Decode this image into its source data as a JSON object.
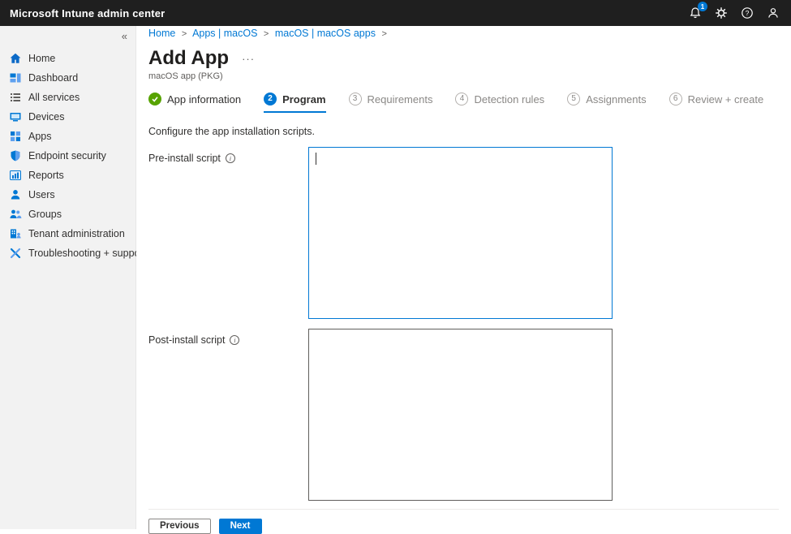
{
  "topbar": {
    "title": "Microsoft Intune admin center",
    "notification_badge": "1",
    "icons": [
      "bell-icon",
      "gear-icon",
      "help-icon",
      "person-icon"
    ]
  },
  "sidebar": {
    "collapse_glyph": "«",
    "items": [
      {
        "label": "Home",
        "icon": "home-icon"
      },
      {
        "label": "Dashboard",
        "icon": "dashboard-icon"
      },
      {
        "label": "All services",
        "icon": "all-services-icon"
      },
      {
        "label": "Devices",
        "icon": "devices-icon"
      },
      {
        "label": "Apps",
        "icon": "apps-icon"
      },
      {
        "label": "Endpoint security",
        "icon": "endpoint-security-icon"
      },
      {
        "label": "Reports",
        "icon": "reports-icon"
      },
      {
        "label": "Users",
        "icon": "users-icon"
      },
      {
        "label": "Groups",
        "icon": "groups-icon"
      },
      {
        "label": "Tenant administration",
        "icon": "tenant-administration-icon"
      },
      {
        "label": "Troubleshooting + support",
        "icon": "troubleshooting-icon"
      }
    ]
  },
  "breadcrumb": {
    "separator": ">",
    "items": [
      "Home",
      "Apps | macOS",
      "macOS | macOS apps"
    ]
  },
  "page": {
    "title": "Add App",
    "menu_glyph": "···",
    "subtitle": "macOS app (PKG)"
  },
  "wizard": {
    "steps": [
      {
        "label": "App information",
        "state": "complete"
      },
      {
        "number": "2",
        "label": "Program",
        "state": "active"
      },
      {
        "number": "3",
        "label": "Requirements",
        "state": "upcoming"
      },
      {
        "number": "4",
        "label": "Detection rules",
        "state": "upcoming"
      },
      {
        "number": "5",
        "label": "Assignments",
        "state": "upcoming"
      },
      {
        "number": "6",
        "label": "Review + create",
        "state": "upcoming"
      }
    ]
  },
  "form": {
    "description": "Configure the app installation scripts.",
    "pre_install": {
      "label": "Pre-install script",
      "value": "",
      "focused": true
    },
    "post_install": {
      "label": "Post-install script",
      "value": "",
      "focused": false
    }
  },
  "footer": {
    "previous_label": "Previous",
    "next_label": "Next"
  },
  "colors": {
    "accent_blue": "#0078d4",
    "success_green": "#57a300",
    "topbar_bg": "#1f1f1f",
    "sidebar_bg": "#f2f2f2"
  }
}
